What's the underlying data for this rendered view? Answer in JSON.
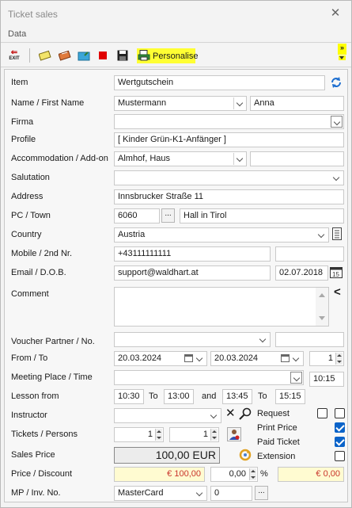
{
  "window": {
    "title": "Ticket sales",
    "close_glyph": "✕"
  },
  "menu": {
    "data": "Data"
  },
  "toolbar": {
    "exit_label": "EXIT",
    "personalise": "Personalise",
    "more_glyph": "»"
  },
  "labels": {
    "item": "Item",
    "name": "Name / First Name",
    "firma": "Firma",
    "profile": "Profile",
    "accommodation": "Accommodation / Add-on",
    "salutation": "Salutation",
    "address": "Address",
    "pc_town": "PC / Town",
    "country": "Country",
    "mobile": "Mobile / 2nd Nr.",
    "email": "Email / D.O.B.",
    "comment": "Comment",
    "voucher": "Voucher Partner / No.",
    "from_to": "From / To",
    "meeting": "Meeting Place / Time",
    "lesson_from": "Lesson from",
    "instructor": "Instructor",
    "tickets": "Tickets / Persons",
    "sales_price": "Sales Price",
    "price_discount": "Price / Discount",
    "mp_inv": "MP / Inv. No."
  },
  "values": {
    "item": "Wertgutschein",
    "last_name": "Mustermann",
    "first_name": "Anna",
    "firma": "",
    "profile": "[ Kinder Grün-K1-Anfänger ]",
    "accommodation": "Almhof, Haus",
    "addon": "",
    "salutation": "",
    "address": "Innsbrucker Straße 11",
    "postcode": "6060",
    "town": "Hall in Tirol",
    "country": "Austria",
    "mobile": "+43111111111",
    "second_nr": "",
    "email": "support@waldhart.at",
    "dob": "02.07.2018",
    "comment": "",
    "voucher_partner": "",
    "voucher_no": "",
    "from_date": "20.03.2024",
    "to_date": "20.03.2024",
    "days": "1",
    "meeting_place": "",
    "meeting_time": "10:15",
    "lesson_1_start": "10:30",
    "lesson_1_end": "13:00",
    "lesson_2_start": "13:45",
    "lesson_2_end": "15:15",
    "instructor": "",
    "tickets": "1",
    "persons": "1",
    "sales_price": "100,00 EUR",
    "price": "€ 100,00",
    "discount": "0,00",
    "discount_unit": "%",
    "discount_amount": "€ 0,00",
    "payment_method": "MasterCard",
    "invoice_no": "0"
  },
  "connectors": {
    "to": "To",
    "and": "and",
    "to2": "To",
    "ellipsis": "..."
  },
  "options": {
    "request": {
      "label": "Request",
      "checked": false,
      "checked2": false
    },
    "print_price": {
      "label": "Print Price",
      "checked": true
    },
    "paid_ticket": {
      "label": "Paid Ticket",
      "checked": true
    },
    "extension": {
      "label": "Extension",
      "checked": false
    }
  },
  "colors": {
    "accent_yellow": "#ffff33",
    "price_bg": "#fffbd1",
    "price_text": "#c9342b",
    "checkbox_blue": "#0a63c9"
  }
}
